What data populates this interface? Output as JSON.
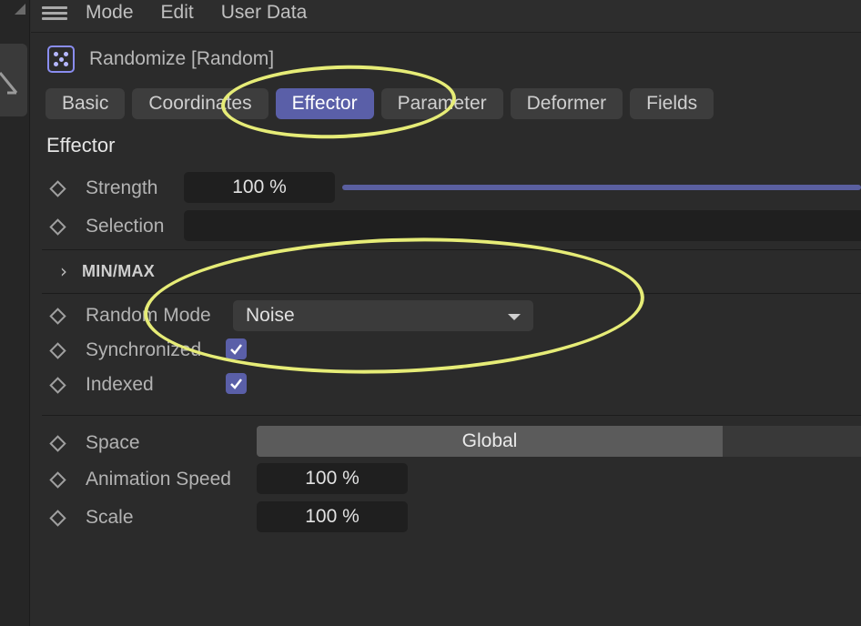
{
  "menu": {
    "items": [
      "Mode",
      "Edit",
      "User Data"
    ]
  },
  "object": {
    "title": "Randomize [Random]",
    "icon": "dice-icon"
  },
  "tabs": [
    {
      "label": "Basic",
      "active": false
    },
    {
      "label": "Coordinates",
      "active": false
    },
    {
      "label": "Effector",
      "active": true
    },
    {
      "label": "Parameter",
      "active": false
    },
    {
      "label": "Deformer",
      "active": false
    },
    {
      "label": "Fields",
      "active": false
    }
  ],
  "section": {
    "heading": "Effector"
  },
  "effector": {
    "strength_label": "Strength",
    "strength_value": "100 %",
    "strength_fraction": 1.0,
    "selection_label": "Selection",
    "selection_value": ""
  },
  "minmax": {
    "label": "MIN/MAX",
    "expanded": false
  },
  "random": {
    "mode_label": "Random Mode",
    "mode_value": "Noise",
    "synchronized_label": "Synchronized",
    "synchronized_checked": true,
    "indexed_label": "Indexed",
    "indexed_checked": true
  },
  "noise": {
    "space_label": "Space",
    "space_value": "Global",
    "speed_label": "Animation Speed",
    "speed_value": "100 %",
    "scale_label": "Scale",
    "scale_value": "100 %"
  },
  "colors": {
    "accent": "#5a5fa8",
    "annotation": "#e6ec77",
    "background": "#2b2b2b"
  }
}
